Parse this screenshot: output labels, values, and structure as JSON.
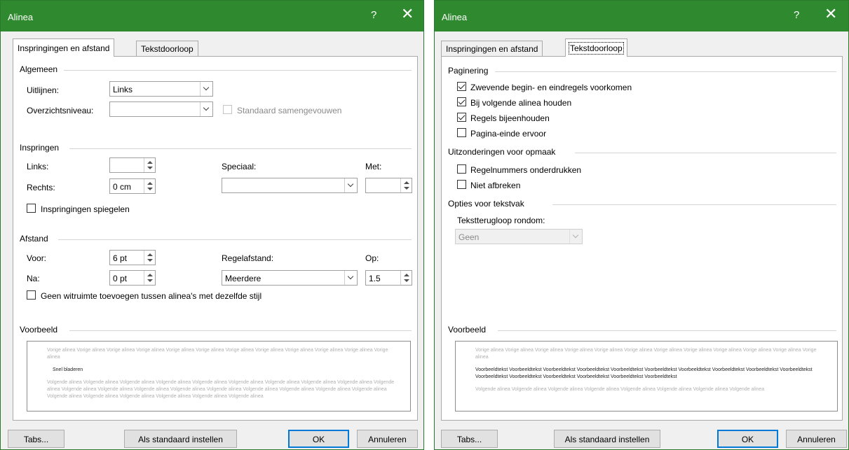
{
  "left_dialog": {
    "title": "Alinea",
    "help": "?",
    "close": "✕",
    "tabs": [
      "Inspringingen en afstand",
      "Tekstdoorloop"
    ],
    "general": {
      "heading": "Algemeen",
      "align_label": "Uitlijnen:",
      "align_value": "Links",
      "outline_label": "Overzichtsniveau:",
      "outline_value": "",
      "collapsed_label": "Standaard samengevouwen"
    },
    "indent": {
      "heading": "Inspringen",
      "left_label": "Links:",
      "left_value": "",
      "right_label": "Rechts:",
      "right_value": "0 cm",
      "special_label": "Speciaal:",
      "special_value": "",
      "by_label": "Met:",
      "by_value": "",
      "mirror_label": "Inspringingen spiegelen"
    },
    "spacing": {
      "heading": "Afstand",
      "before_label": "Voor:",
      "before_value": "6 pt",
      "after_label": "Na:",
      "after_value": "0 pt",
      "linespacing_label": "Regelafstand:",
      "linespacing_value": "Meerdere",
      "at_label": "Op:",
      "at_value": "1.5",
      "nospace_label": "Geen witruimte toevoegen tussen alinea's met dezelfde stijl"
    },
    "preview": {
      "heading": "Voorbeeld",
      "prev_text": "Vorige alinea Vorige alinea Vorige alinea Vorige alinea Vorige alinea Vorige alinea Vorige alinea Vorige alinea Vorige alinea Vorige alinea Vorige alinea Vorige alinea",
      "sample_text": "Snel bladeren",
      "next_text": "Volgende alinea Volgende alinea Volgende alinea Volgende alinea Volgende alinea Volgende alinea Volgende alinea Volgende alinea Volgende alinea Volgende alinea Volgende alinea Volgende alinea Volgende alinea Volgende alinea Volgende alinea Volgende alinea Volgende alinea Volgende alinea Volgende alinea Volgende alinea Volgende alinea Volgende alinea Volgende alinea Volgende alinea Volgende alinea"
    },
    "buttons": {
      "tabs": "Tabs...",
      "default": "Als standaard instellen",
      "ok": "OK",
      "cancel": "Annuleren"
    }
  },
  "right_dialog": {
    "title": "Alinea",
    "help": "?",
    "close": "✕",
    "tabs": [
      "Inspringingen en afstand",
      "Tekstdoorloop"
    ],
    "pagination": {
      "heading": "Paginering",
      "widow_label": "Zwevende begin- en eindregels voorkomen",
      "keepnext_label": "Bij volgende alinea houden",
      "keeplines_label": "Regels bijeenhouden",
      "pagebreak_label": "Pagina-einde ervoor"
    },
    "exceptions": {
      "heading": "Uitzonderingen voor opmaak",
      "suppress_label": "Regelnummers onderdrukken",
      "nohyphen_label": "Niet afbreken"
    },
    "textbox": {
      "heading": "Opties voor tekstvak",
      "wrap_label": "Tekstterugloop rondom:",
      "wrap_value": "Geen"
    },
    "preview": {
      "heading": "Voorbeeld",
      "prev_text": "Vorige alinea Vorige alinea Vorige alinea Vorige alinea Vorige alinea Vorige alinea Vorige alinea Vorige alinea Vorige alinea Vorige alinea Vorige alinea Vorige alinea",
      "sample_text": "Voorbeeldtekst Voorbeeldtekst Voorbeeldtekst Voorbeeldtekst Voorbeeldtekst Voorbeeldtekst Voorbeeldtekst Voorbeeldtekst Voorbeeldtekst Voorbeeldtekst Voorbeeldtekst Voorbeeldtekst Voorbeeldtekst Voorbeeldtekst Voorbeeldtekst Voorbeeldtekst",
      "next_text": "Volgende alinea Volgende alinea Volgende alinea Volgende alinea Volgende alinea Volgende alinea Volgende alinea Volgende alinea"
    },
    "buttons": {
      "tabs": "Tabs...",
      "default": "Als standaard instellen",
      "ok": "OK",
      "cancel": "Annuleren"
    }
  },
  "colors": {
    "titlebar": "#2f8a2f",
    "dialog_bg": "#f0f0f0",
    "panel_bg": "#ffffff",
    "focus_border": "#0078d7"
  }
}
